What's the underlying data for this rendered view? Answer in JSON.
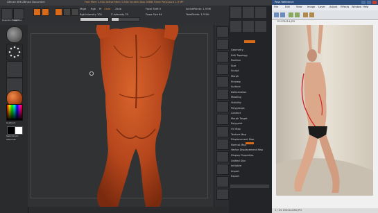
{
  "zbrush": {
    "title": "ZBrush 4R6  ZBrush Document",
    "title_info": "Free Mem 1.9Gb  Active Mem 1.9Gb  Scratch Disk 50MB  Timer  PolyCount 1.9 MP",
    "topbar": {
      "projection_master": "Projection Master",
      "lightbox": "LightBox",
      "edit": "Edit",
      "draw": "Draw",
      "move": "Move",
      "scale": "Scale",
      "rotate": "Rotate",
      "mrgb": "Mrgb",
      "rgb": "Rgb",
      "m": "M",
      "zadd": "Zadd",
      "zsub": "Zsub",
      "focal_shift": "Focal Shift 0",
      "draw_size": "Draw Size 64",
      "z_intensity": "Z Intensity 25",
      "rgb_intensity": "Rgb Intensity 100",
      "active_points": "ActivePoints: 1.9 Mil",
      "total_points": "TotalPoints: 1.9 Mil",
      "z_intensity_value": 0.25,
      "rgb_intensity_value": 1.0
    },
    "shelf": {
      "gradient": "Gradient",
      "switch_color": "SwitchColor",
      "alternate": "Alternate"
    },
    "palette": {
      "items": [
        "Geometry",
        "Edit Topology",
        "Position",
        "Size",
        "Sculpt",
        "Morph",
        "Preview",
        "Surface",
        "Deformation",
        "Masking",
        "Visibility",
        "Polygroups",
        "Contact",
        "Morph Target",
        "Polypaint",
        "UV Map",
        "Texture Map",
        "Displacement Map",
        "Normal Map",
        "Vector Displacement Map",
        "Display Properties",
        "Unified Skin",
        "Initialize",
        "Import",
        "Export"
      ],
      "subtool_labels": [
        "SubTool",
        "Layers",
        "FiberMesh",
        "Geometry HD"
      ],
      "bottom_items": [
        "Layers",
        "FiberMesh",
        "Geometry HD",
        "Preview",
        "Surface"
      ]
    },
    "accent": "#d86a1a",
    "model_color": "#b8491f"
  },
  "reference_viewer": {
    "title": "Pose Reference",
    "menu": [
      "File",
      "Edit",
      "View",
      "Image",
      "Layer",
      "Adjust",
      "Effects",
      "Window",
      "Help"
    ],
    "status": "1 / 24  1920x1280  JPG",
    "photo_label": "P1070014.JPG"
  }
}
